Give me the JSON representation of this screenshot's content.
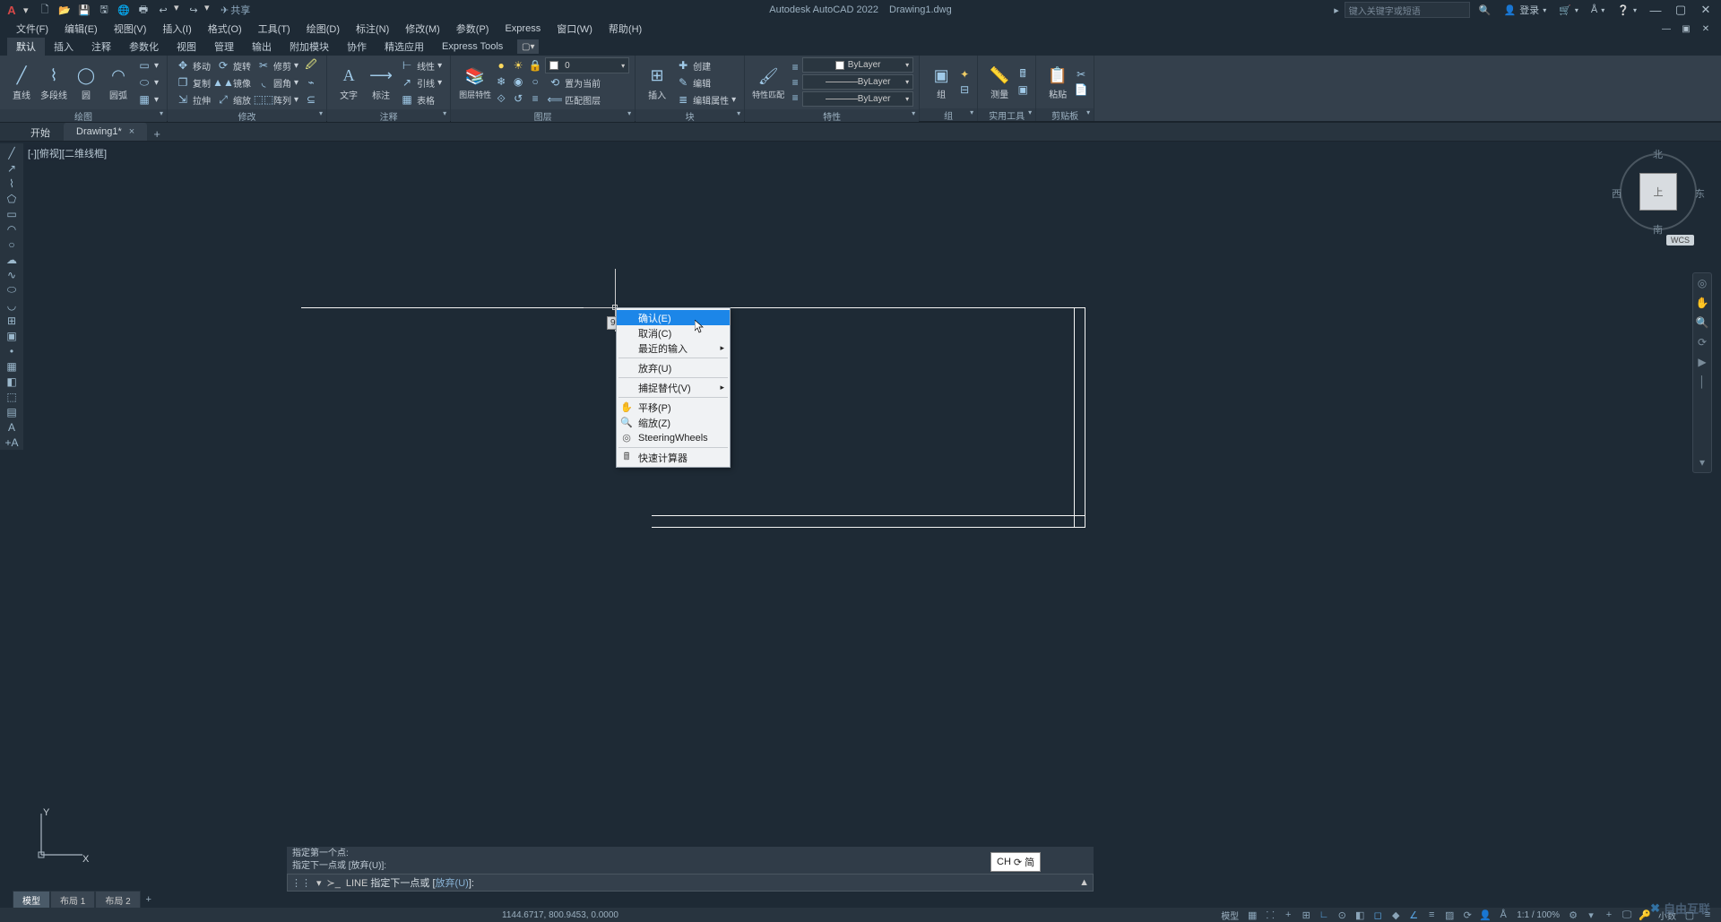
{
  "title": {
    "app": "Autodesk AutoCAD 2022",
    "doc": "Drawing1.dwg"
  },
  "share_label": "共享",
  "search_placeholder": "键入关键字或短语",
  "login_label": "登录",
  "menus": [
    "文件(F)",
    "编辑(E)",
    "视图(V)",
    "插入(I)",
    "格式(O)",
    "工具(T)",
    "绘图(D)",
    "标注(N)",
    "修改(M)",
    "参数(P)",
    "Express",
    "窗口(W)",
    "帮助(H)"
  ],
  "ribbon_tabs": [
    "默认",
    "插入",
    "注释",
    "参数化",
    "视图",
    "管理",
    "输出",
    "附加模块",
    "协作",
    "精选应用",
    "Express Tools"
  ],
  "ribbon_active_tab": 0,
  "panels": {
    "draw": {
      "title": "绘图",
      "line": "直线",
      "polyline": "多段线",
      "circle": "圆",
      "arc": "圆弧"
    },
    "modify": {
      "title": "修改",
      "move": "移动",
      "rotate": "旋转",
      "trim": "修剪",
      "copy": "复制",
      "mirror": "镜像",
      "fillet": "圆角",
      "stretch": "拉伸",
      "scale": "缩放",
      "array": "阵列"
    },
    "annotate": {
      "title": "注释",
      "text": "文字",
      "dim": "标注",
      "linear": "线性",
      "leader": "引线",
      "table": "表格"
    },
    "layer": {
      "title": "图层",
      "props": "图层特性",
      "current": "0",
      "set_current": "置为当前",
      "match": "匹配图层"
    },
    "block": {
      "title": "块",
      "insert": "插入",
      "create": "创建",
      "edit": "编辑",
      "attr": "编辑属性"
    },
    "props": {
      "title": "特性",
      "match": "特性匹配",
      "color": "ByLayer",
      "lw": "ByLayer",
      "lt": "ByLayer"
    },
    "group": {
      "title": "组",
      "label": "组"
    },
    "utils": {
      "title": "实用工具",
      "measure": "测量"
    },
    "clip": {
      "title": "剪贴板",
      "paste": "粘贴"
    }
  },
  "file_tabs": {
    "start": "开始",
    "active": "Drawing1*"
  },
  "viewport_label": "[-][俯视][二维线框]",
  "viewcube": {
    "top": "上",
    "n": "北",
    "s": "南",
    "e": "东",
    "w": "西",
    "wcs": "WCS"
  },
  "ucs": {
    "x": "X",
    "y": "Y"
  },
  "ctx_menu": {
    "confirm": "确认(E)",
    "cancel": "取消(C)",
    "recent": "最近的输入",
    "undo": "放弃(U)",
    "snap": "捕捉替代(V)",
    "pan": "平移(P)",
    "zoom": "缩放(Z)",
    "wheels": "SteeringWheels",
    "calc": "快速计算器"
  },
  "angle_tip": "90",
  "cmd_history": [
    "指定第一个点:",
    "指定下一点或 [放弃(U)]:"
  ],
  "cmd_prompt_prefix": "LINE",
  "cmd_prompt_text": "指定下一点或 [",
  "cmd_prompt_link": "放弃(U)",
  "cmd_prompt_suffix": "]:",
  "ime": {
    "lang": "CH",
    "mode": "简"
  },
  "layout_tabs": [
    "模型",
    "布局 1",
    "布局 2"
  ],
  "status": {
    "coords": "1144.6717, 800.9453, 0.0000",
    "space": "模型",
    "zoom": "1:1 / 100%",
    "scale": "小数"
  },
  "watermark": "自由互联"
}
